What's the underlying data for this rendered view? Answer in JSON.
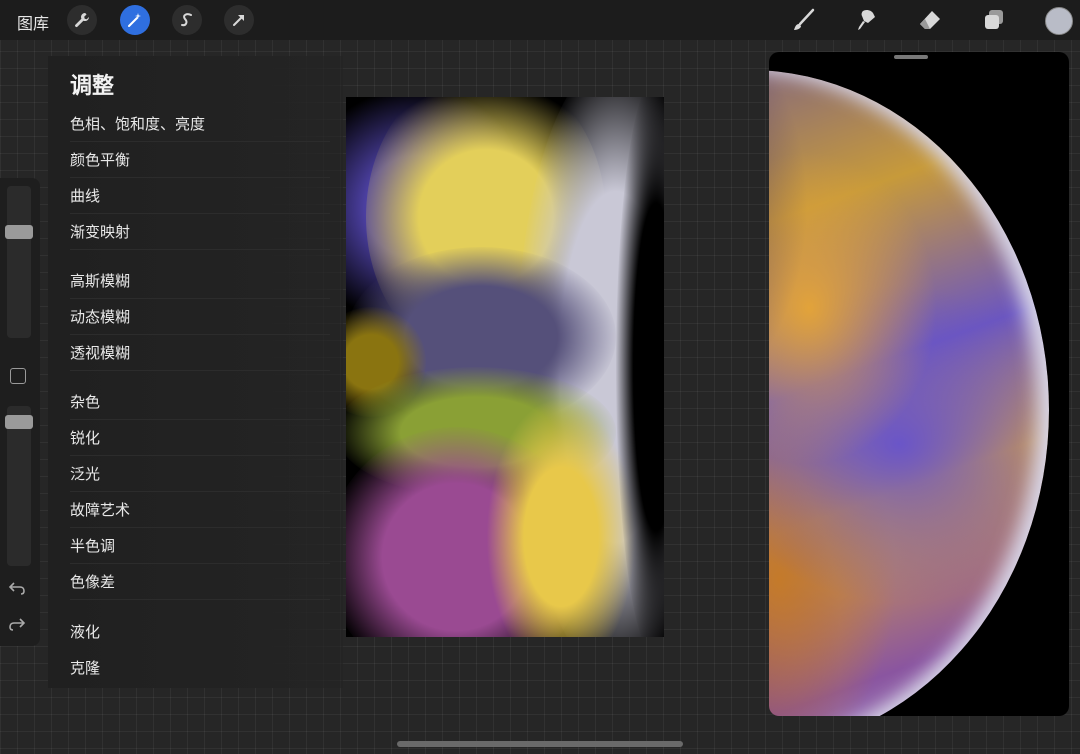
{
  "topbar": {
    "gallery_label": "图库",
    "left_tools": [
      "wrench-icon",
      "magic-wand-icon",
      "selection-icon",
      "arrow-icon"
    ],
    "right_tools": [
      "brush-icon",
      "smudge-icon",
      "eraser-icon",
      "layers-icon"
    ],
    "active_tool": "magic-wand-icon",
    "current_color": "#b9bcc7",
    "active_color": "#2f6fe0"
  },
  "sidebar": {
    "brush_size_level": 0.3,
    "opacity_level": 0.05,
    "icons": [
      "modify-square-icon",
      "undo-icon",
      "redo-icon"
    ]
  },
  "menu": {
    "title": "调整",
    "items": [
      "色相、饱和度、亮度",
      "颜色平衡",
      "曲线",
      "渐变映射",
      "高斯模糊",
      "动态模糊",
      "透视模糊",
      "杂色",
      "锐化",
      "泛光",
      "故障艺术",
      "半色调",
      "色像差",
      "液化",
      "克隆"
    ]
  }
}
